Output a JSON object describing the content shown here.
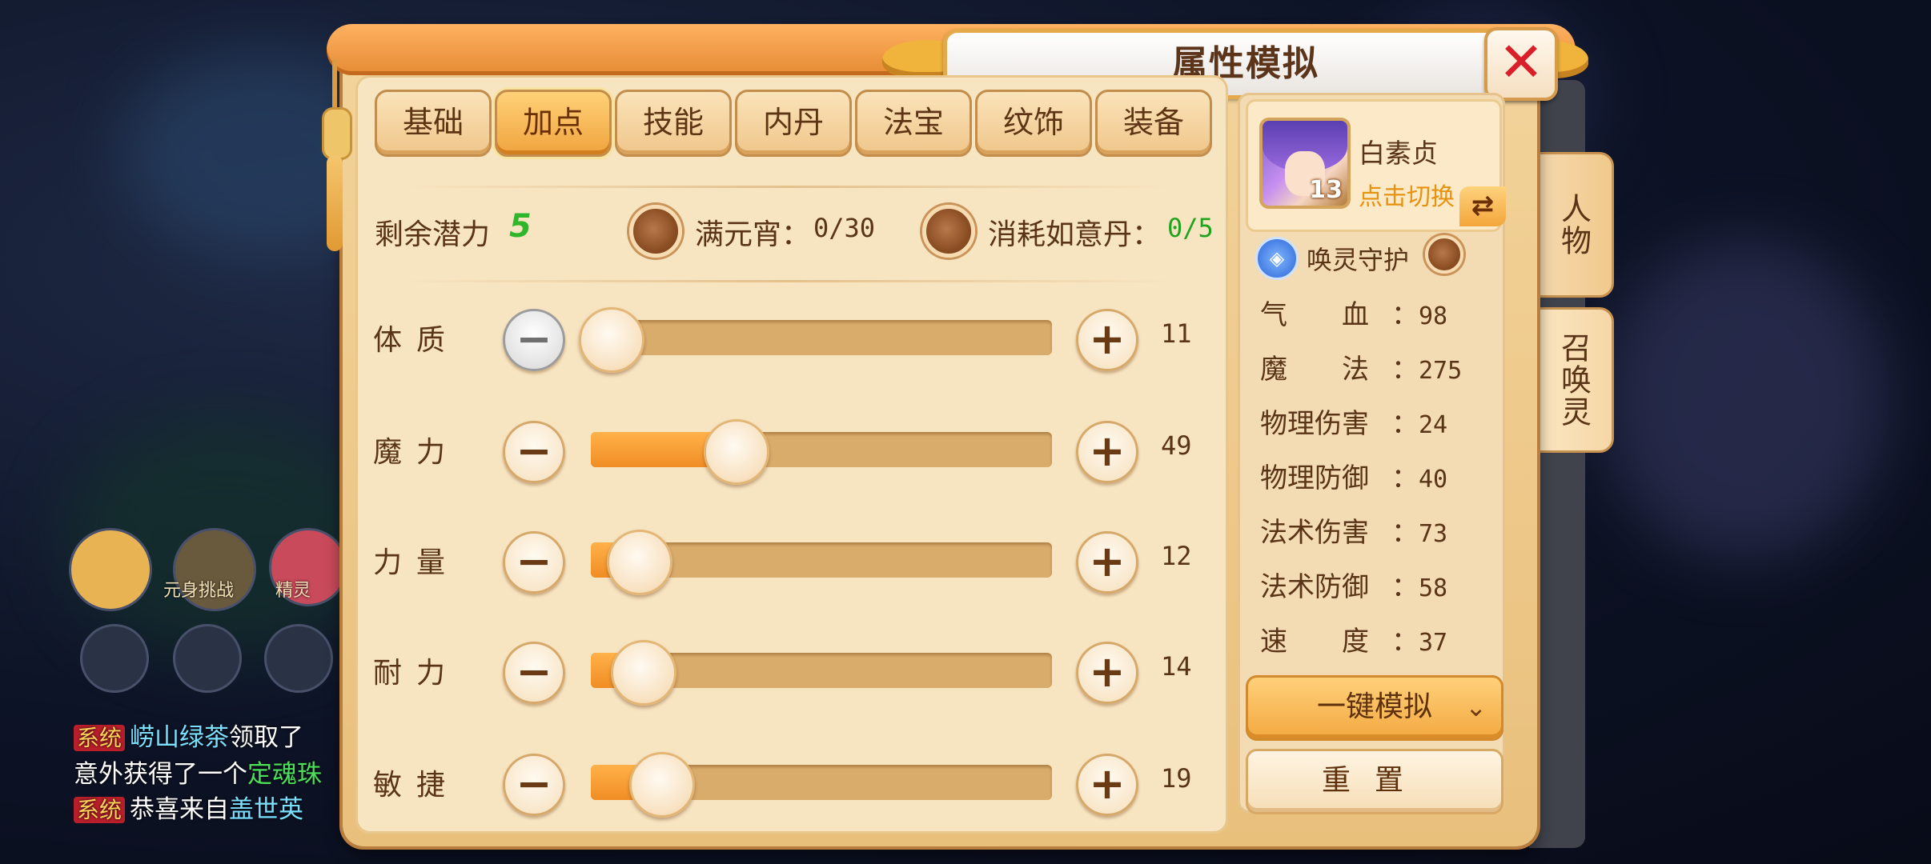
{
  "dialog": {
    "title": "属性模拟",
    "close_icon": "close-icon"
  },
  "tabs": [
    {
      "label": "基础",
      "active": false
    },
    {
      "label": "加点",
      "active": true
    },
    {
      "label": "技能",
      "active": false
    },
    {
      "label": "内丹",
      "active": false
    },
    {
      "label": "法宝",
      "active": false
    },
    {
      "label": "纹饰",
      "active": false
    },
    {
      "label": "装备",
      "active": false
    }
  ],
  "potential": {
    "label": "剩余潜力",
    "value": "5",
    "option1_label": "满元宵：",
    "option1_value": "0/30",
    "option2_label": "消耗如意丹：",
    "option2_value": "0/5"
  },
  "attributes": [
    {
      "name": "体质",
      "value": "11",
      "fill": 0.04,
      "minus_disabled": true
    },
    {
      "name": "魔力",
      "value": "49",
      "fill": 0.31,
      "minus_disabled": false
    },
    {
      "name": "力量",
      "value": "12",
      "fill": 0.1,
      "minus_disabled": false
    },
    {
      "name": "耐力",
      "value": "14",
      "fill": 0.11,
      "minus_disabled": false
    },
    {
      "name": "敏捷",
      "value": "19",
      "fill": 0.15,
      "minus_disabled": false
    }
  ],
  "pet": {
    "name": "白素贞",
    "level": "13",
    "switch_label": "点击切换",
    "guard_label": "唤灵守护"
  },
  "stats": [
    {
      "name": "气　　血",
      "value": "98"
    },
    {
      "name": "魔　　法",
      "value": "275"
    },
    {
      "name": "物理伤害",
      "value": "24"
    },
    {
      "name": "物理防御",
      "value": "40"
    },
    {
      "name": "法术伤害",
      "value": "73"
    },
    {
      "name": "法术防御",
      "value": "58"
    },
    {
      "name": "速　　度",
      "value": "37"
    }
  ],
  "buttons": {
    "simulate": "一键模拟",
    "reset": "重置"
  },
  "side_tabs": [
    {
      "label": "人物"
    },
    {
      "label": "召唤灵"
    }
  ],
  "background_hud": {
    "labels": [
      "元身挑战",
      "精灵"
    ],
    "chat": [
      {
        "tag": "系统",
        "name": "崂山绿茶",
        "text": "领取了"
      },
      {
        "tag": "",
        "name": "",
        "text": "意外获得了一个",
        "highlight": "定魂珠"
      },
      {
        "tag": "系统",
        "name": "",
        "text": "恭喜来自",
        "highlight": "盖世英"
      }
    ]
  },
  "colors": {
    "accent_orange": "#f08d24",
    "brand_brown": "#5a3416",
    "close_red": "#d9202a",
    "potential_green": "#2fb62a"
  }
}
